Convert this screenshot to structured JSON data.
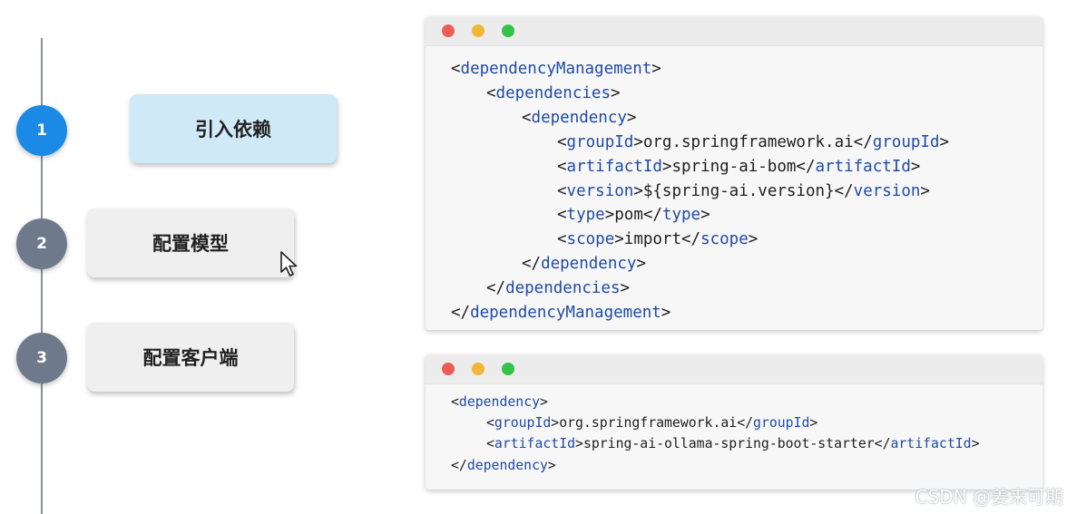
{
  "steps": [
    {
      "number": "1",
      "label": "引入依赖",
      "state": "active"
    },
    {
      "number": "2",
      "label": "配置模型",
      "state": "inactive"
    },
    {
      "number": "3",
      "label": "配置客户端",
      "state": "inactive"
    }
  ],
  "colors": {
    "active_circle": "#1a8ae6",
    "inactive_circle": "#6e7a8c",
    "active_card": "#cfe9f7",
    "inactive_card": "#efefef",
    "tag_blue": "#1f4aa8",
    "dot_red": "#ee5c55",
    "dot_yellow": "#f2b635",
    "dot_green": "#34c248"
  },
  "code_window_1": {
    "lines": [
      {
        "indent": 0,
        "open": "dependencyManagement",
        "text": "",
        "close": ""
      },
      {
        "indent": 1,
        "open": "dependencies",
        "text": "",
        "close": ""
      },
      {
        "indent": 2,
        "open": "dependency",
        "text": "",
        "close": ""
      },
      {
        "indent": 3,
        "open": "groupId",
        "text": "org.springframework.ai",
        "close": "groupId"
      },
      {
        "indent": 3,
        "open": "artifactId",
        "text": "spring-ai-bom",
        "close": "artifactId"
      },
      {
        "indent": 3,
        "open": "version",
        "text": "${spring-ai.version}",
        "close": "version"
      },
      {
        "indent": 3,
        "open": "type",
        "text": "pom",
        "close": "type"
      },
      {
        "indent": 3,
        "open": "scope",
        "text": "import",
        "close": "scope"
      },
      {
        "indent": 2,
        "open": "",
        "text": "",
        "close": "dependency"
      },
      {
        "indent": 1,
        "open": "",
        "text": "",
        "close": "dependencies"
      },
      {
        "indent": 0,
        "open": "",
        "text": "",
        "close": "dependencyManagement"
      }
    ]
  },
  "code_window_2": {
    "lines": [
      {
        "indent": 0,
        "open": "dependency",
        "text": "",
        "close": ""
      },
      {
        "indent": 1,
        "open": "groupId",
        "text": "org.springframework.ai",
        "close": "groupId"
      },
      {
        "indent": 1,
        "open": "artifactId",
        "text": "spring-ai-ollama-spring-boot-starter",
        "close": "artifactId"
      },
      {
        "indent": 0,
        "open": "",
        "text": "",
        "close": "dependency"
      }
    ]
  },
  "watermark": "CSDN @姜来可期"
}
